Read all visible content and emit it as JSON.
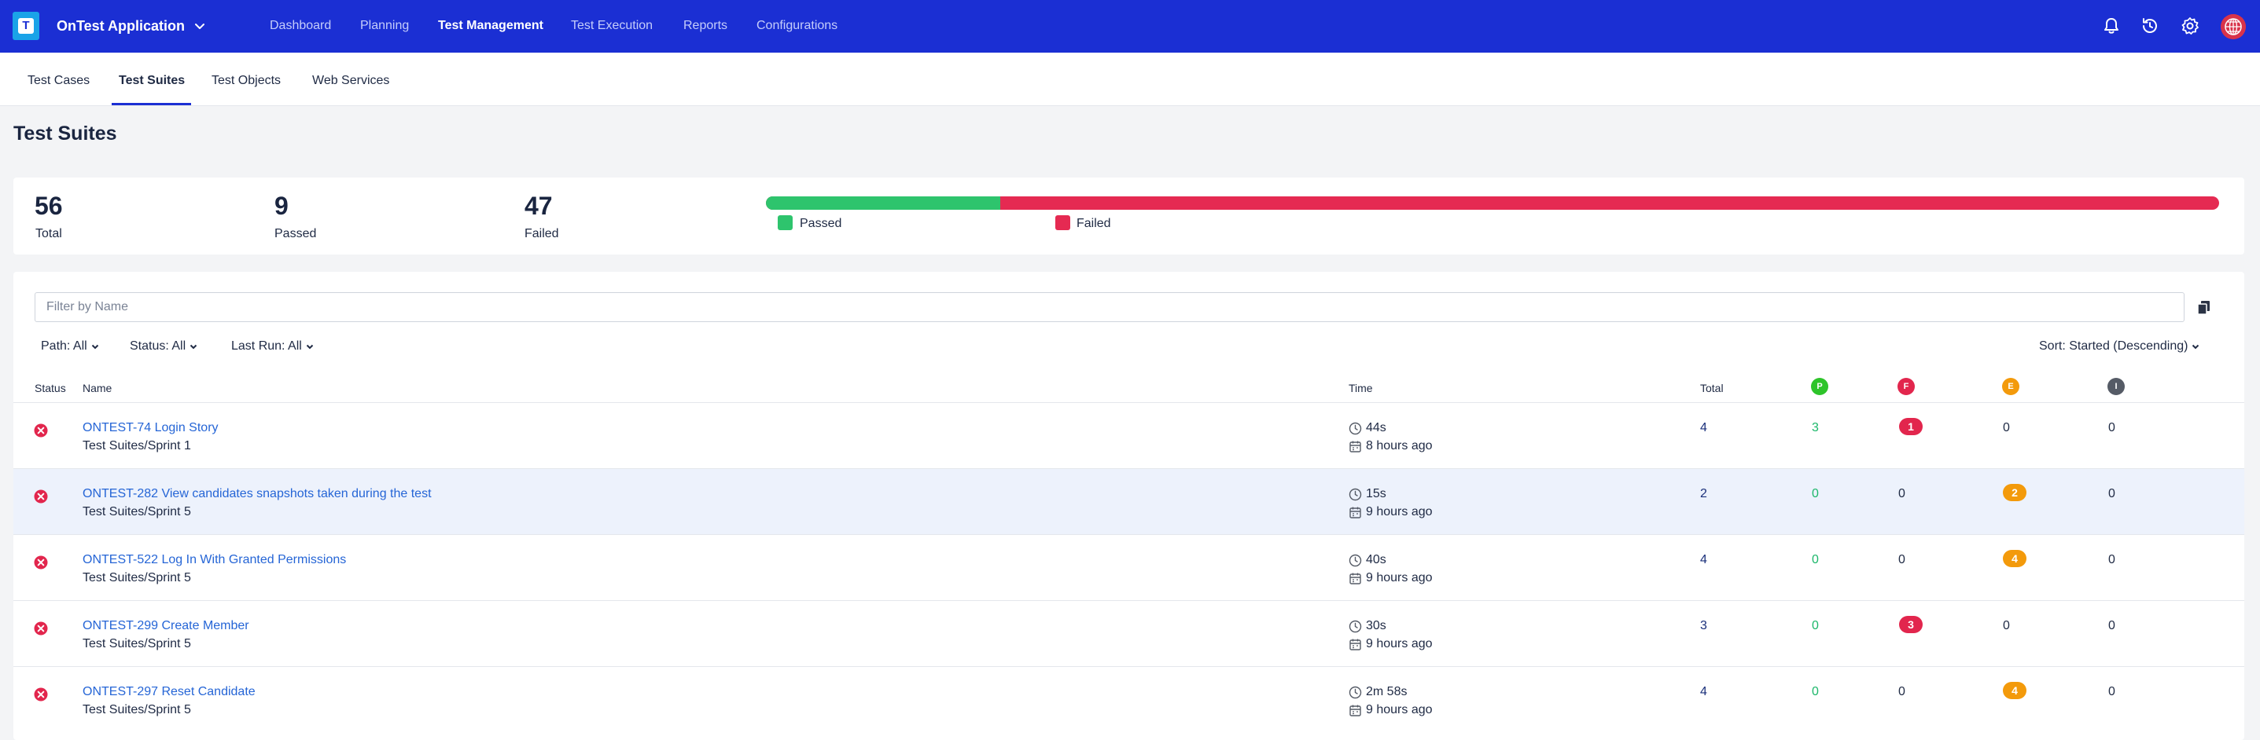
{
  "app": {
    "title": "OnTest Application",
    "logo_letter": "T"
  },
  "nav": {
    "items": [
      {
        "label": "Dashboard",
        "active": false
      },
      {
        "label": "Planning",
        "active": false
      },
      {
        "label": "Test Management",
        "active": true
      },
      {
        "label": "Test Execution",
        "active": false
      },
      {
        "label": "Reports",
        "active": false
      },
      {
        "label": "Configurations",
        "active": false
      }
    ],
    "icons": [
      "bell-icon",
      "history-icon",
      "gear-icon",
      "avatar"
    ]
  },
  "subtabs": [
    {
      "label": "Test Cases",
      "active": false
    },
    {
      "label": "Test Suites",
      "active": true
    },
    {
      "label": "Test Objects",
      "active": false
    },
    {
      "label": "Web Services",
      "active": false
    }
  ],
  "page_title": "Test Suites",
  "summary": {
    "total": {
      "value": "56",
      "label": "Total"
    },
    "passed": {
      "value": "9",
      "label": "Passed"
    },
    "failed": {
      "value": "47",
      "label": "Failed"
    },
    "pass_ratio": 0.161,
    "legend": {
      "passed": "Passed",
      "failed": "Failed"
    },
    "colors": {
      "passed": "#2ec46d",
      "failed": "#e52a52"
    }
  },
  "filter": {
    "placeholder": "Filter by Name",
    "path": "Path: All",
    "status": "Status: All",
    "last_run": "Last Run: All",
    "sort_label": "Sort:",
    "sort_value": "Started (Descending)"
  },
  "table": {
    "headers": {
      "status": "Status",
      "name": "Name",
      "time": "Time",
      "total": "Total",
      "passed_badge": "P",
      "failed_badge": "F",
      "error_badge": "E",
      "incomplete_badge": "I"
    },
    "badge_colors": {
      "passed": "#2ec42a",
      "failed": "#e2264d",
      "error": "#f39a0b",
      "incomplete": "#555b66"
    },
    "rows": [
      {
        "name": "ONTEST-74 Login Story",
        "path": "Test Suites/Sprint 1",
        "duration": "44s",
        "when": "8 hours ago",
        "total": "4",
        "passed": "3",
        "failed": "1",
        "error": "0",
        "incomplete": "0",
        "highlight": false
      },
      {
        "name": "ONTEST-282 View candidates snapshots taken during the test",
        "path": "Test Suites/Sprint 5",
        "duration": "15s",
        "when": "9 hours ago",
        "total": "2",
        "passed": "0",
        "failed": "0",
        "error": "2",
        "incomplete": "0",
        "highlight": true
      },
      {
        "name": "ONTEST-522 Log In With Granted Permissions",
        "path": "Test Suites/Sprint 5",
        "duration": "40s",
        "when": "9 hours ago",
        "total": "4",
        "passed": "0",
        "failed": "0",
        "error": "4",
        "incomplete": "0",
        "highlight": false
      },
      {
        "name": "ONTEST-299 Create Member",
        "path": "Test Suites/Sprint 5",
        "duration": "30s",
        "when": "9 hours ago",
        "total": "3",
        "passed": "0",
        "failed": "3",
        "error": "0",
        "incomplete": "0",
        "highlight": false
      },
      {
        "name": "ONTEST-297 Reset Candidate",
        "path": "Test Suites/Sprint 5",
        "duration": "2m 58s",
        "when": "9 hours ago",
        "total": "4",
        "passed": "0",
        "failed": "0",
        "error": "4",
        "incomplete": "0",
        "highlight": false
      }
    ]
  }
}
